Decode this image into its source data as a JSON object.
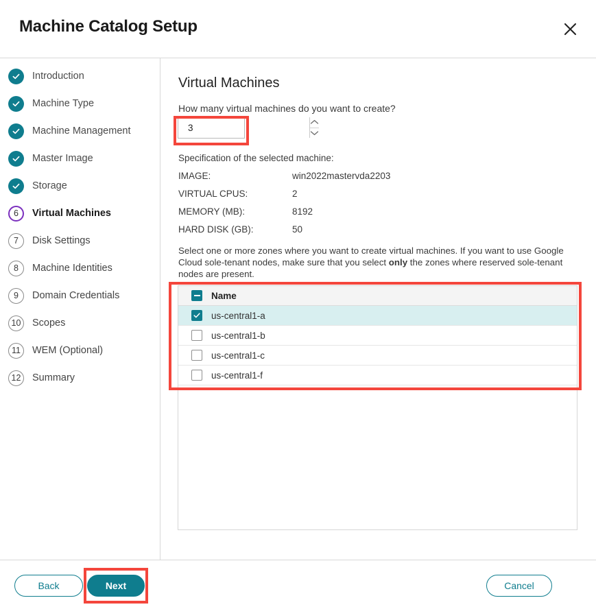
{
  "window": {
    "title": "Machine Catalog Setup",
    "close_icon": "close-icon"
  },
  "theme": {
    "accent_teal": "#0f7d8e",
    "active_step_purple": "#7b2fbe",
    "selected_row_teal": "#d8eff0",
    "annotation_red": "#f4463c"
  },
  "sidebar": {
    "items": [
      {
        "num": "1",
        "label": "Introduction",
        "state": "done"
      },
      {
        "num": "2",
        "label": "Machine Type",
        "state": "done"
      },
      {
        "num": "3",
        "label": "Machine Management",
        "state": "done"
      },
      {
        "num": "4",
        "label": "Master Image",
        "state": "done"
      },
      {
        "num": "5",
        "label": "Storage",
        "state": "done"
      },
      {
        "num": "6",
        "label": "Virtual Machines",
        "state": "active"
      },
      {
        "num": "7",
        "label": "Disk Settings",
        "state": "todo"
      },
      {
        "num": "8",
        "label": "Machine Identities",
        "state": "todo"
      },
      {
        "num": "9",
        "label": "Domain Credentials",
        "state": "todo"
      },
      {
        "num": "10",
        "label": "Scopes",
        "state": "todo"
      },
      {
        "num": "11",
        "label": "WEM (Optional)",
        "state": "todo"
      },
      {
        "num": "12",
        "label": "Summary",
        "state": "todo"
      }
    ]
  },
  "main": {
    "panel_title": "Virtual Machines",
    "question": "How many virtual machines do you want to create?",
    "vm_count": "3",
    "spec_heading": "Specification of the selected machine:",
    "specs": [
      {
        "label": "IMAGE:",
        "value": "win2022mastervda2203"
      },
      {
        "label": "VIRTUAL CPUS:",
        "value": "2"
      },
      {
        "label": "MEMORY (MB):",
        "value": "8192"
      },
      {
        "label": "HARD DISK (GB):",
        "value": "50"
      }
    ],
    "zones_desc_part1": "Select one or more zones where you want to create virtual machines. If you want to use Google Cloud sole-tenant nodes, make sure that you select ",
    "zones_desc_bold": "only",
    "zones_desc_part2": " the zones where reserved sole-tenant nodes are present.",
    "table": {
      "header": "Name",
      "header_checkbox_state": "indeterminate",
      "rows": [
        {
          "name": "us-central1-a",
          "checked": true
        },
        {
          "name": "us-central1-b",
          "checked": false
        },
        {
          "name": "us-central1-c",
          "checked": false
        },
        {
          "name": "us-central1-f",
          "checked": false
        }
      ]
    }
  },
  "footer": {
    "back_label": "Back",
    "next_label": "Next",
    "cancel_label": "Cancel"
  }
}
